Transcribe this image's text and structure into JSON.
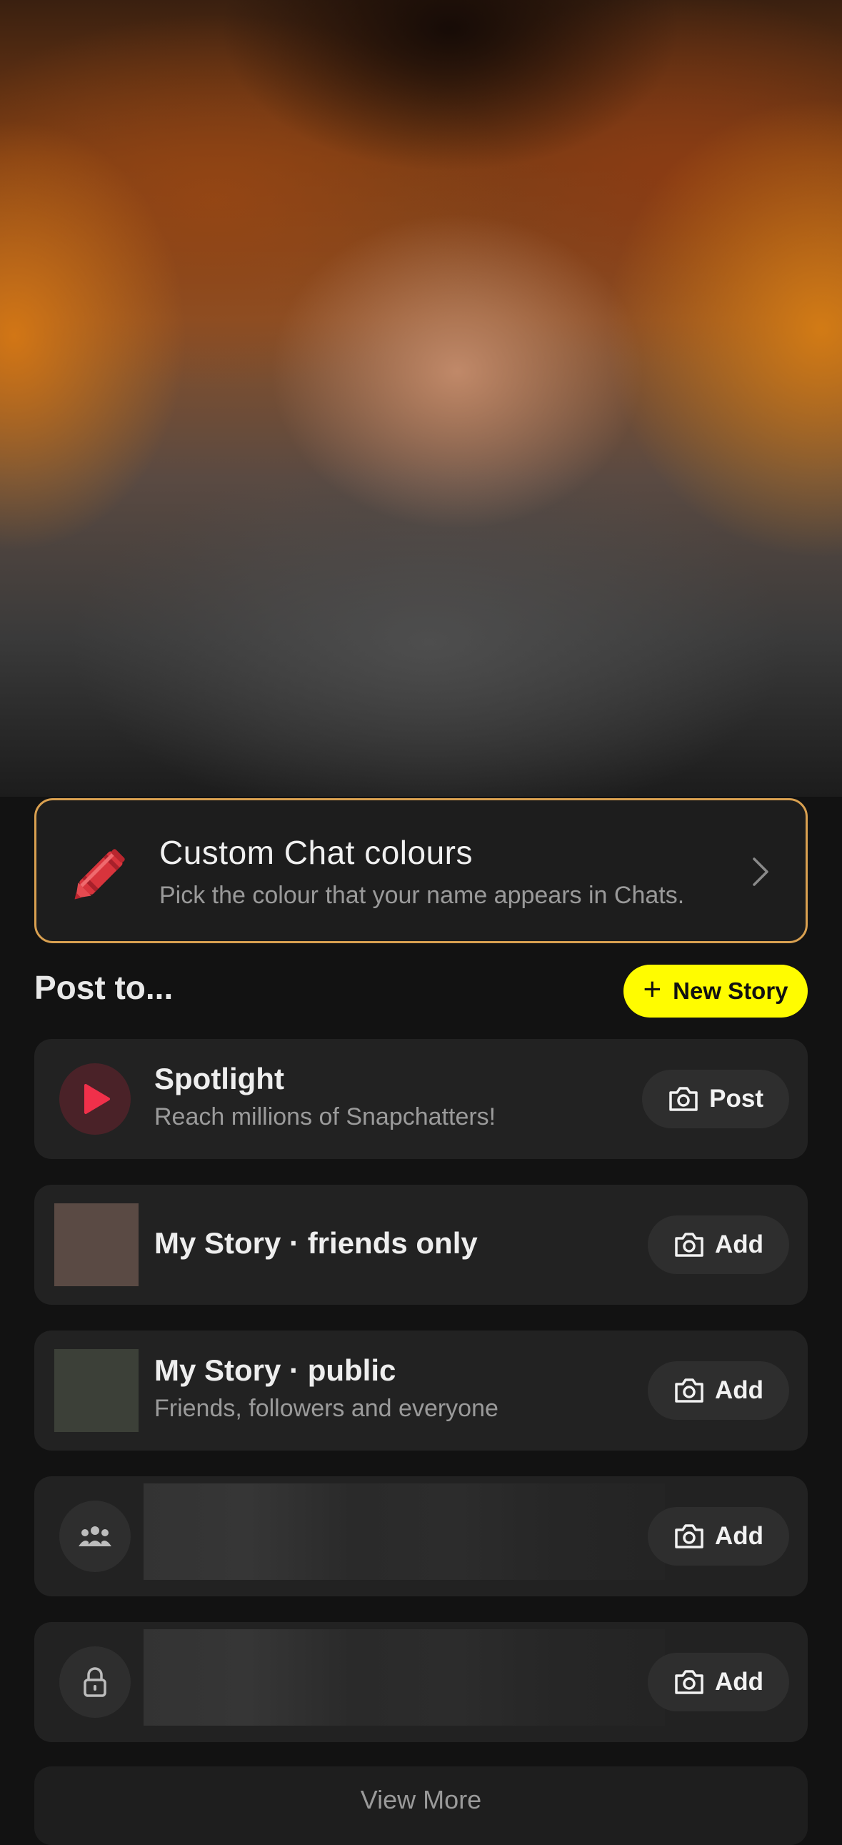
{
  "promo": {
    "title": "Custom Chat colours",
    "subtitle": "Pick the colour that your name appears in Chats.",
    "icon": "crayon-icon",
    "border_color": "#d9a050"
  },
  "post_to": {
    "heading": "Post to...",
    "new_story_label": "New Story",
    "new_story_color": "#fffc00"
  },
  "destinations": [
    {
      "name": "Spotlight",
      "desc": "Reach millions of Snapchatters!",
      "action": "Post",
      "icon": "spotlight-play-icon"
    },
    {
      "name": "My Story · friends only",
      "desc": "",
      "action": "Add",
      "thumb_color": "#5a4a44"
    },
    {
      "name": "My Story · public",
      "desc": "Friends, followers and everyone",
      "action": "Add",
      "thumb_color": "#3c4038"
    },
    {
      "name": "",
      "desc": "",
      "action": "Add",
      "icon": "group-icon"
    },
    {
      "name": "",
      "desc": "",
      "action": "Add",
      "icon": "lock-icon"
    }
  ],
  "view_more_label": "View More"
}
